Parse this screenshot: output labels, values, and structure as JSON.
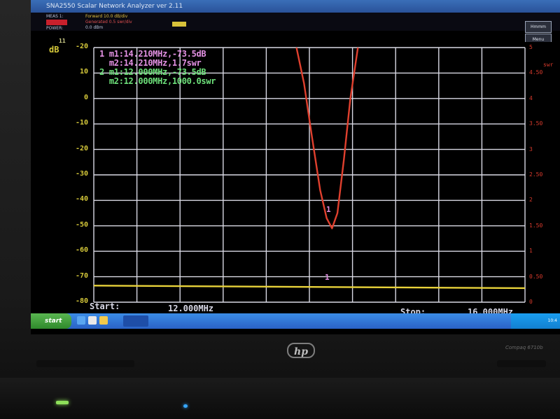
{
  "app": {
    "title": "SNA2550  Scalar Network Analyzer ver 2.11",
    "status_label_1": "MEAS 1:",
    "status_label_2": "POWER:",
    "status_value_1": "Forward 10.0 dB/div",
    "status_value_2": "Generated 0.5 swr/div",
    "status_value_3": "0.0 dBm",
    "button_1": "Hmmm",
    "button_2": "Menu"
  },
  "plot": {
    "left_unit": "dB",
    "left_ticks": [
      "-20",
      "10",
      "0",
      "-10",
      "-20",
      "-30",
      "-40",
      "-50",
      "-60",
      "-70",
      "-80"
    ],
    "right_ticks": [
      "5",
      "4.50",
      "4",
      "3.50",
      "3",
      "2.50",
      "2",
      "1.50",
      "1",
      "0.50",
      "0"
    ],
    "right_unit": "swr",
    "top_label": "11",
    "marker_line_1": "1 m1:14.210MHz,-73.5dB",
    "marker_line_2": "  m2:14.210MHz,1.7swr",
    "marker_line_3": "2 m1:12.000MHz,-73.5dB",
    "marker_line_4": "  m2:12.000MHz,1000.0swr",
    "marker_tag_1": "1",
    "marker_tag_2": "1",
    "start_label": "Start:",
    "start_value": "12.000MHz",
    "stop_label": "Stop:",
    "stop_value": "16.000MHz"
  },
  "chart_data": {
    "type": "line",
    "x_range_mhz": [
      12.0,
      16.0
    ],
    "ylim_db": [
      -80,
      20
    ],
    "y2lim_swr": [
      0,
      5
    ],
    "series": [
      {
        "color": "#e0402e",
        "axis": "swr",
        "x": [
          13.88,
          13.95,
          14.02,
          14.1,
          14.16,
          14.21,
          14.26,
          14.32,
          14.38,
          14.45
        ],
        "values": [
          5.0,
          4.3,
          3.3,
          2.2,
          1.65,
          1.45,
          1.75,
          2.8,
          4.0,
          5.0
        ]
      },
      {
        "color": "#e8d23a",
        "axis": "db",
        "x": [
          12.0,
          16.0
        ],
        "values": [
          -73.5,
          -74.5
        ]
      }
    ]
  },
  "taskbar": {
    "start_label": "start",
    "clock": "10:4"
  },
  "laptop": {
    "logo": "hp",
    "model": "Compaq 6710b"
  }
}
